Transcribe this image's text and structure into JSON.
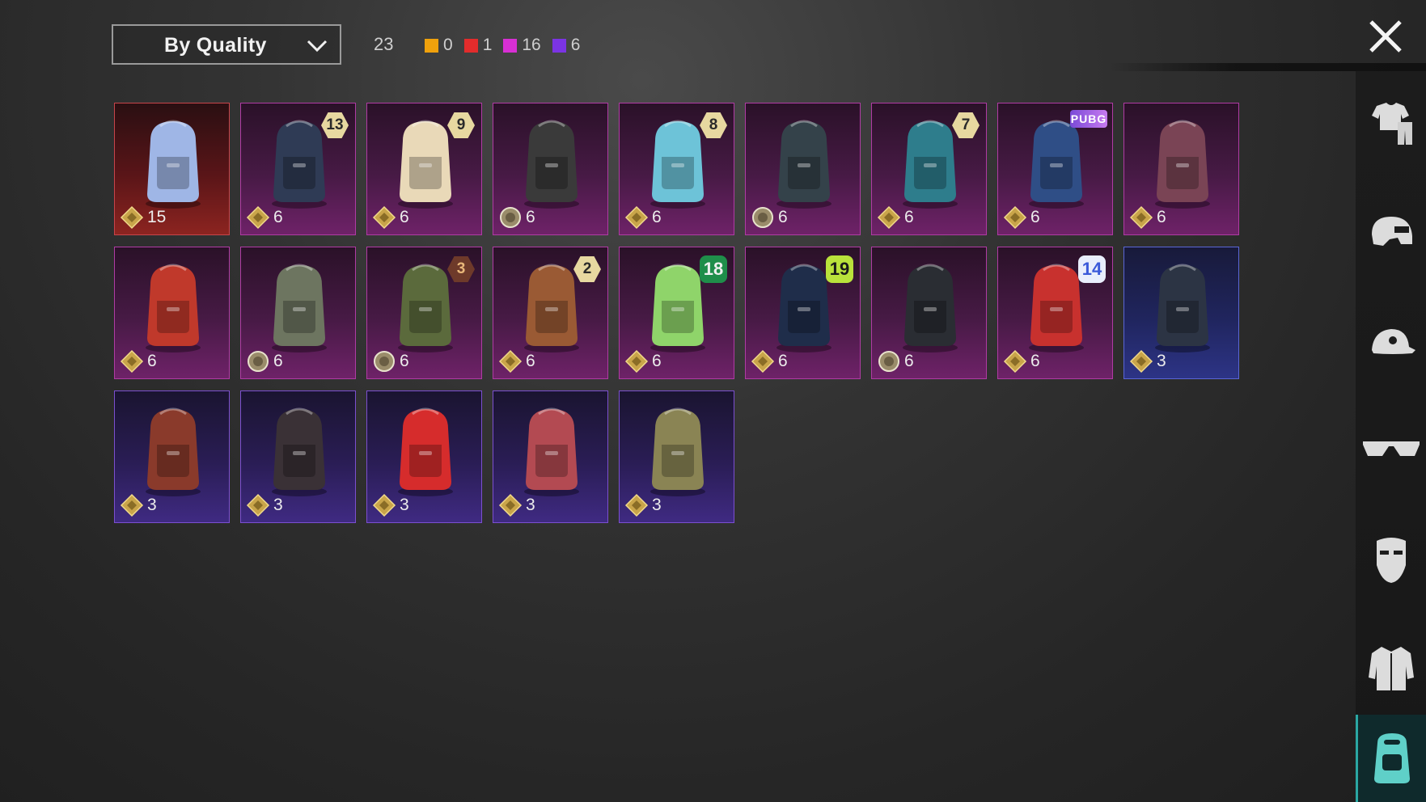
{
  "toolbar": {
    "sort_label": "By Quality",
    "total": "23",
    "legend": [
      {
        "color": "#f0a10c",
        "count": "0"
      },
      {
        "color": "#e22c2c",
        "count": "1"
      },
      {
        "color": "#d82fd4",
        "count": "16"
      },
      {
        "color": "#7b34e3",
        "count": "6"
      }
    ]
  },
  "sidebar": {
    "items": [
      {
        "icon": "outfit-icon",
        "active": false
      },
      {
        "icon": "helmet-icon",
        "active": false
      },
      {
        "icon": "cap-icon",
        "active": false
      },
      {
        "icon": "glasses-icon",
        "active": false
      },
      {
        "icon": "mask-icon",
        "active": false
      },
      {
        "icon": "jacket-icon",
        "active": false
      },
      {
        "icon": "backpack-icon",
        "active": true
      }
    ]
  },
  "items": [
    {
      "value": "15",
      "quality": "red",
      "badge": null,
      "badge_style": null,
      "art": "#9fb6e6",
      "coin": "gold"
    },
    {
      "value": "6",
      "quality": "pink",
      "badge": "13",
      "badge_style": "hex",
      "art": "#2f3b55",
      "coin": "gold"
    },
    {
      "value": "6",
      "quality": "pink",
      "badge": "9",
      "badge_style": "hex",
      "art": "#e9d9b8",
      "coin": "gold"
    },
    {
      "value": "6",
      "quality": "pink",
      "badge": null,
      "badge_style": null,
      "art": "#3a3a3a",
      "coin": "silver"
    },
    {
      "value": "6",
      "quality": "pink",
      "badge": "8",
      "badge_style": "hex",
      "art": "#6dc3d8",
      "coin": "gold"
    },
    {
      "value": "6",
      "quality": "pink",
      "badge": null,
      "badge_style": null,
      "art": "#34424a",
      "coin": "silver"
    },
    {
      "value": "6",
      "quality": "pink",
      "badge": "7",
      "badge_style": "hex",
      "art": "#2e7d8c",
      "coin": "gold"
    },
    {
      "value": "6",
      "quality": "pink",
      "badge": "PUBG",
      "badge_style": "tag",
      "art": "#2f4e86",
      "coin": "gold"
    },
    {
      "value": "6",
      "quality": "pink",
      "badge": null,
      "badge_style": null,
      "art": "#7a4455",
      "coin": "gold"
    },
    {
      "value": "6",
      "quality": "pink",
      "badge": null,
      "badge_style": null,
      "art": "#c0392b",
      "coin": "gold"
    },
    {
      "value": "6",
      "quality": "pink",
      "badge": null,
      "badge_style": null,
      "art": "#6d7560",
      "coin": "silver"
    },
    {
      "value": "6",
      "quality": "pink",
      "badge": "3",
      "badge_style": "rust",
      "art": "#5b6a3c",
      "coin": "silver"
    },
    {
      "value": "6",
      "quality": "pink",
      "badge": "2",
      "badge_style": "hex",
      "art": "#9a5a34",
      "coin": "gold"
    },
    {
      "value": "6",
      "quality": "pink",
      "badge": "18",
      "badge_style": "green",
      "art": "#8fd46a",
      "coin": "gold"
    },
    {
      "value": "6",
      "quality": "pink",
      "badge": "19",
      "badge_style": "lime",
      "art": "#1f2d4a",
      "coin": "gold"
    },
    {
      "value": "6",
      "quality": "pink",
      "badge": null,
      "badge_style": null,
      "art": "#2a2d33",
      "coin": "silver"
    },
    {
      "value": "6",
      "quality": "pink",
      "badge": "14",
      "badge_style": "blue",
      "art": "#c8312e",
      "coin": "gold"
    },
    {
      "value": "3",
      "quality": "blue",
      "badge": null,
      "badge_style": null,
      "art": "#2c3444",
      "coin": "gold"
    },
    {
      "value": "3",
      "quality": "purple",
      "badge": null,
      "badge_style": null,
      "art": "#8a3a2b",
      "coin": "gold"
    },
    {
      "value": "3",
      "quality": "purple",
      "badge": null,
      "badge_style": null,
      "art": "#3a3136",
      "coin": "gold"
    },
    {
      "value": "3",
      "quality": "purple",
      "badge": null,
      "badge_style": null,
      "art": "#d62c2c",
      "coin": "gold"
    },
    {
      "value": "3",
      "quality": "purple",
      "badge": null,
      "badge_style": null,
      "art": "#b34a52",
      "coin": "gold"
    },
    {
      "value": "3",
      "quality": "purple",
      "badge": null,
      "badge_style": null,
      "art": "#8a8454",
      "coin": "gold"
    }
  ]
}
